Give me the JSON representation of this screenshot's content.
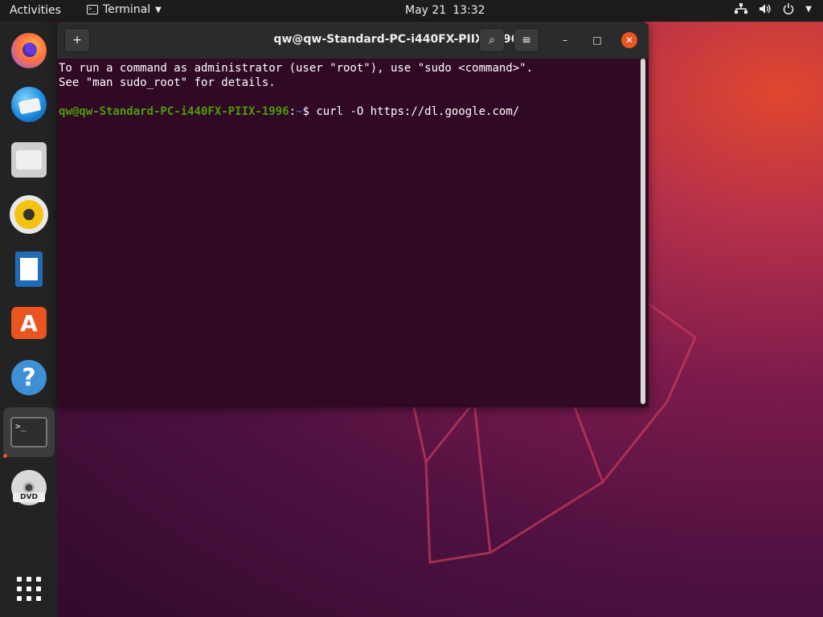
{
  "topbar": {
    "activities": "Activities",
    "app_name": "Terminal",
    "date": "May 21",
    "time": "13:32",
    "icons": [
      "network-icon",
      "volume-icon",
      "power-icon",
      "chevron-down-icon"
    ]
  },
  "dock": {
    "items": [
      {
        "name": "firefox",
        "icon": "firefox-icon"
      },
      {
        "name": "thunderbird",
        "icon": "thunderbird-icon"
      },
      {
        "name": "files",
        "icon": "files-icon"
      },
      {
        "name": "rhythmbox",
        "icon": "rhythmbox-icon"
      },
      {
        "name": "libreoffice-writer",
        "icon": "writer-icon"
      },
      {
        "name": "ubuntu-software",
        "icon": "store-icon",
        "glyph": "A"
      },
      {
        "name": "help",
        "icon": "help-icon",
        "glyph": "?"
      },
      {
        "name": "terminal",
        "icon": "terminal-icon",
        "glyph": ">_",
        "running": true
      },
      {
        "name": "dvd",
        "icon": "dvd-icon"
      },
      {
        "name": "show-applications",
        "icon": "app-grid-icon"
      }
    ]
  },
  "window": {
    "title": "qw@qw-Standard-PC-i440FX-PIIX-1996: ~",
    "new_tab_glyph": "+",
    "search_glyph": "⌕",
    "menu_glyph": "≡",
    "minimize_glyph": "–",
    "maximize_glyph": "□",
    "close_glyph": "✕"
  },
  "terminal": {
    "line1": "To run a command as administrator (user \"root\"), use \"sudo <command>\".",
    "line2": "See \"man sudo_root\" for details.",
    "prompt_user": "qw@qw-Standard-PC-i440FX-PIIX-1996",
    "prompt_sep": ":",
    "prompt_path": "~",
    "prompt_symbol": "$ ",
    "command": "curl -O https://dl.google.com/"
  },
  "colors": {
    "prompt_user": "#4e9a06",
    "prompt_path": "#3465a4",
    "terminal_bg": "#300a24",
    "accent": "#e95420"
  }
}
